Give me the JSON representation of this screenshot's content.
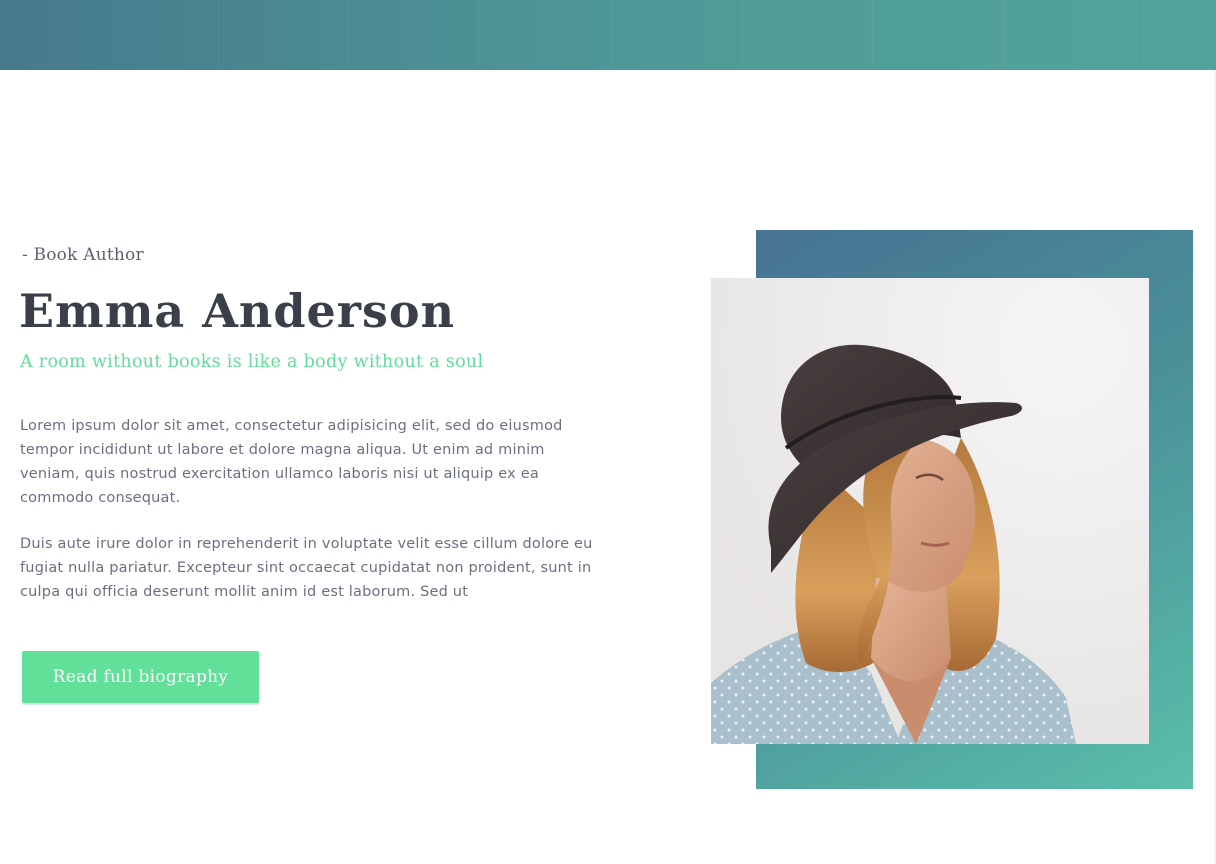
{
  "hero": {
    "subtitle": "- Book Author",
    "name": "Emma Anderson",
    "tagline": "A room without books is like a body without a soul",
    "paragraphs": [
      "Lorem ipsum dolor sit amet, consectetur adipisicing elit, sed do eiusmod tempor incididunt ut labore et dolore magna aliqua. Ut enim ad minim veniam, quis nostrud exercitation ullamco laboris nisi ut aliquip ex ea commodo consequat.",
      "Duis aute irure dolor in reprehenderit in voluptate velit esse cillum dolore eu fugiat nulla pariatur. Excepteur sint occaecat cupidatat non proident, sunt in culpa qui officia deserunt mollit anim id est laborum. Sed ut"
    ],
    "button_label": "Read full biography"
  },
  "colors": {
    "accent_green": "#62e09a",
    "heading": "#3a3f4a",
    "body_text": "#6b7080",
    "band_gradient_start": "#467a8c",
    "band_gradient_end": "#52a49a"
  }
}
